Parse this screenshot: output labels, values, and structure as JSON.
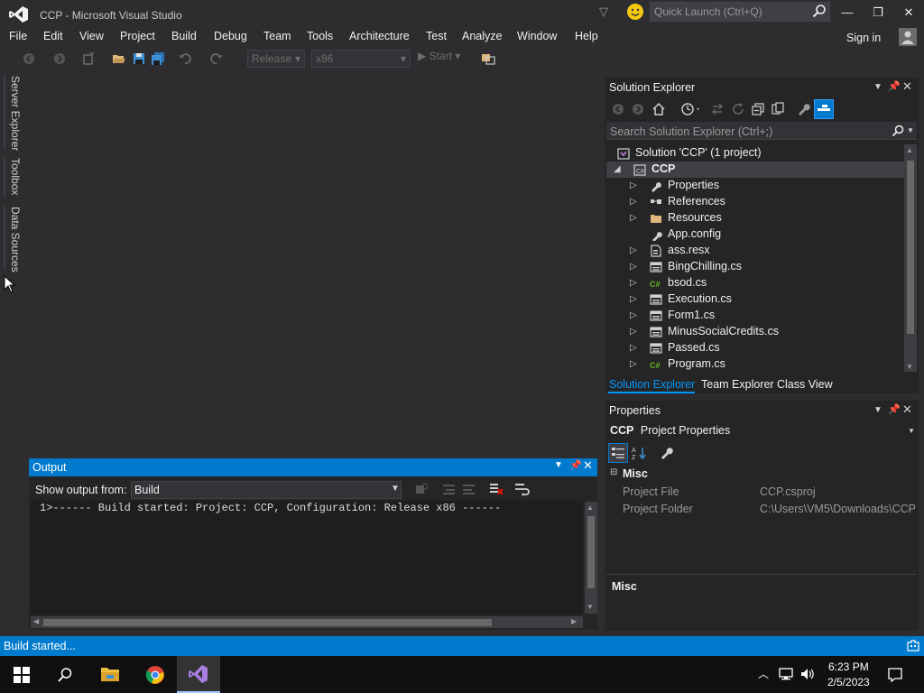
{
  "window": {
    "title": "CCP - Microsoft Visual Studio",
    "quick_launch_placeholder": "Quick Launch (Ctrl+Q)",
    "accent": "#007acc"
  },
  "menu": {
    "items": [
      "File",
      "Edit",
      "View",
      "Project",
      "Build",
      "Debug",
      "Team",
      "Tools",
      "Architecture",
      "Test",
      "Analyze",
      "Window",
      "Help"
    ],
    "sign_in": "Sign in"
  },
  "toolbar": {
    "configuration": "Release",
    "platform": "x86",
    "start_label": "Start"
  },
  "left_dock": {
    "tabs": [
      "Server Explorer",
      "Toolbox",
      "Data Sources"
    ]
  },
  "output": {
    "title": "Output",
    "show_from_label": "Show output from:",
    "source": "Build",
    "lines": [
      "1>------ Build started: Project: CCP, Configuration: Release x86 ------"
    ]
  },
  "solution_explorer": {
    "title": "Solution Explorer",
    "search_placeholder": "Search Solution Explorer (Ctrl+;)",
    "solution_label": "Solution 'CCP' (1 project)",
    "project_label": "CCP",
    "items": [
      {
        "label": "Properties",
        "icon": "wrench-icon",
        "expandable": true
      },
      {
        "label": "References",
        "icon": "references-icon",
        "expandable": true
      },
      {
        "label": "Resources",
        "icon": "folder-icon",
        "expandable": true
      },
      {
        "label": "App.config",
        "icon": "config-file-icon",
        "expandable": false
      },
      {
        "label": "ass.resx",
        "icon": "resx-file-icon",
        "expandable": true
      },
      {
        "label": "BingChilling.cs",
        "icon": "form-file-icon",
        "expandable": true
      },
      {
        "label": "bsod.cs",
        "icon": "csharp-file-icon",
        "expandable": true
      },
      {
        "label": "Execution.cs",
        "icon": "form-file-icon",
        "expandable": true
      },
      {
        "label": "Form1.cs",
        "icon": "form-file-icon",
        "expandable": true
      },
      {
        "label": "MinusSocialCredits.cs",
        "icon": "form-file-icon",
        "expandable": true
      },
      {
        "label": "Passed.cs",
        "icon": "form-file-icon",
        "expandable": true
      },
      {
        "label": "Program.cs",
        "icon": "csharp-file-icon",
        "expandable": true
      }
    ],
    "tabs": [
      "Solution Explorer",
      "Team Explorer",
      "Class View"
    ]
  },
  "properties": {
    "title": "Properties",
    "object_name": "CCP",
    "object_type": "Project Properties",
    "category": "Misc",
    "rows": [
      {
        "name": "Project File",
        "value": "CCP.csproj"
      },
      {
        "name": "Project Folder",
        "value": "C:\\Users\\VM5\\Downloads\\CCP\\"
      }
    ],
    "description_title": "Misc"
  },
  "status": {
    "text": "Build started..."
  },
  "taskbar": {
    "time": "6:23 PM",
    "date": "2/5/2023"
  }
}
